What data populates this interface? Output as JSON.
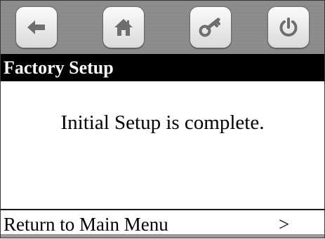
{
  "toolbar": {
    "buttons": [
      {
        "icon": "back-arrow-icon"
      },
      {
        "icon": "home-icon"
      },
      {
        "icon": "key-icon"
      },
      {
        "icon": "power-icon"
      }
    ]
  },
  "title": "Factory Setup",
  "message": "Initial Setup is complete.",
  "menu": {
    "return_label": "Return to Main Menu",
    "chevron": ">"
  },
  "colors": {
    "toolbar_bg": "#8c8c8c",
    "title_bar_bg": "#000000",
    "title_text": "#ffffff",
    "icon_gray": "#6e6e6e"
  }
}
